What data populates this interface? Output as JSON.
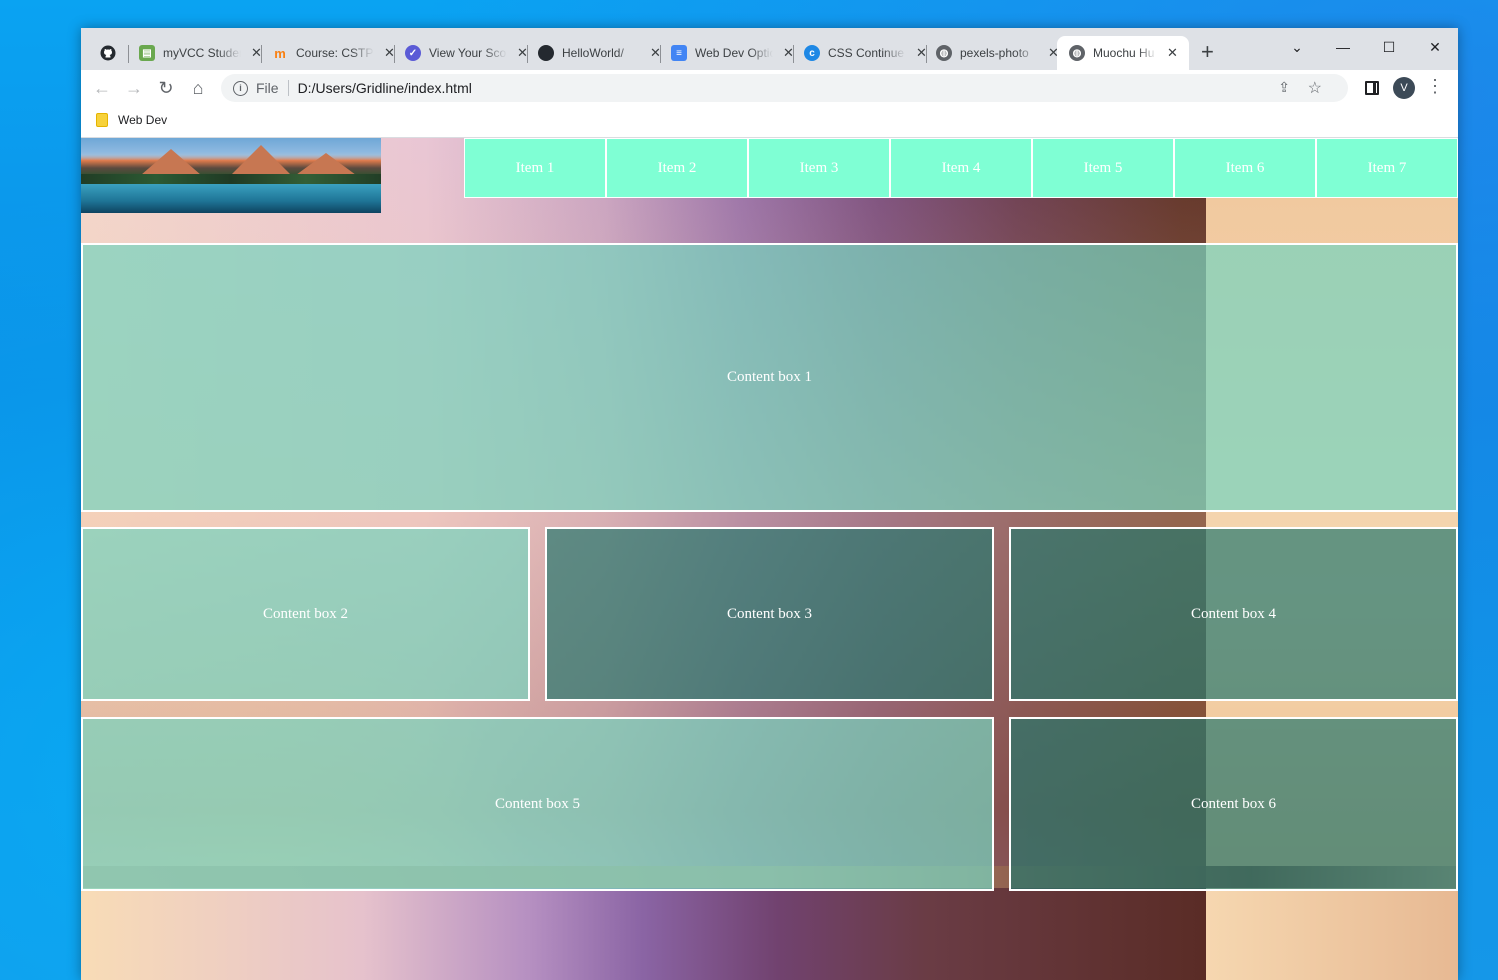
{
  "browser": {
    "tabs": [
      {
        "title": "myVCC Student",
        "favicon": "myvcc-icon",
        "color": "#6aa84f"
      },
      {
        "title": "Course: CSTP",
        "favicon": "moodle-icon",
        "color": "#f98012"
      },
      {
        "title": "View Your Score",
        "favicon": "quiz-icon",
        "color": "#5b5bd6"
      },
      {
        "title": "HelloWorld/",
        "favicon": "github-icon",
        "color": "#24292f"
      },
      {
        "title": "Web Dev Options",
        "favicon": "docs-icon",
        "color": "#4285f4"
      },
      {
        "title": "CSS Continue",
        "favicon": "c-icon",
        "color": "#1e88e5"
      },
      {
        "title": "pexels-photo",
        "favicon": "globe-icon",
        "color": "#5f6368"
      },
      {
        "title": "Muochu Hu",
        "favicon": "globe-icon",
        "color": "#5f6368"
      }
    ],
    "active_tab_index": 7,
    "new_tab": "+",
    "window_controls": {
      "list": "⌄",
      "minimize": "—",
      "maximize": "☐",
      "close": "✕"
    },
    "address": {
      "scheme": "File",
      "url": "D:/Users/Gridline/index.html"
    },
    "profile_initial": "V",
    "bookmarks": [
      {
        "label": "Web Dev"
      }
    ]
  },
  "page": {
    "nav_items": [
      "Item 1",
      "Item 2",
      "Item 3",
      "Item 4",
      "Item 5",
      "Item 6",
      "Item 7"
    ],
    "content_boxes": [
      "Content box 1",
      "Content box 2",
      "Content box 3",
      "Content box 4",
      "Content box 5",
      "Content box 6"
    ],
    "nav_color": "#7fffd4"
  }
}
